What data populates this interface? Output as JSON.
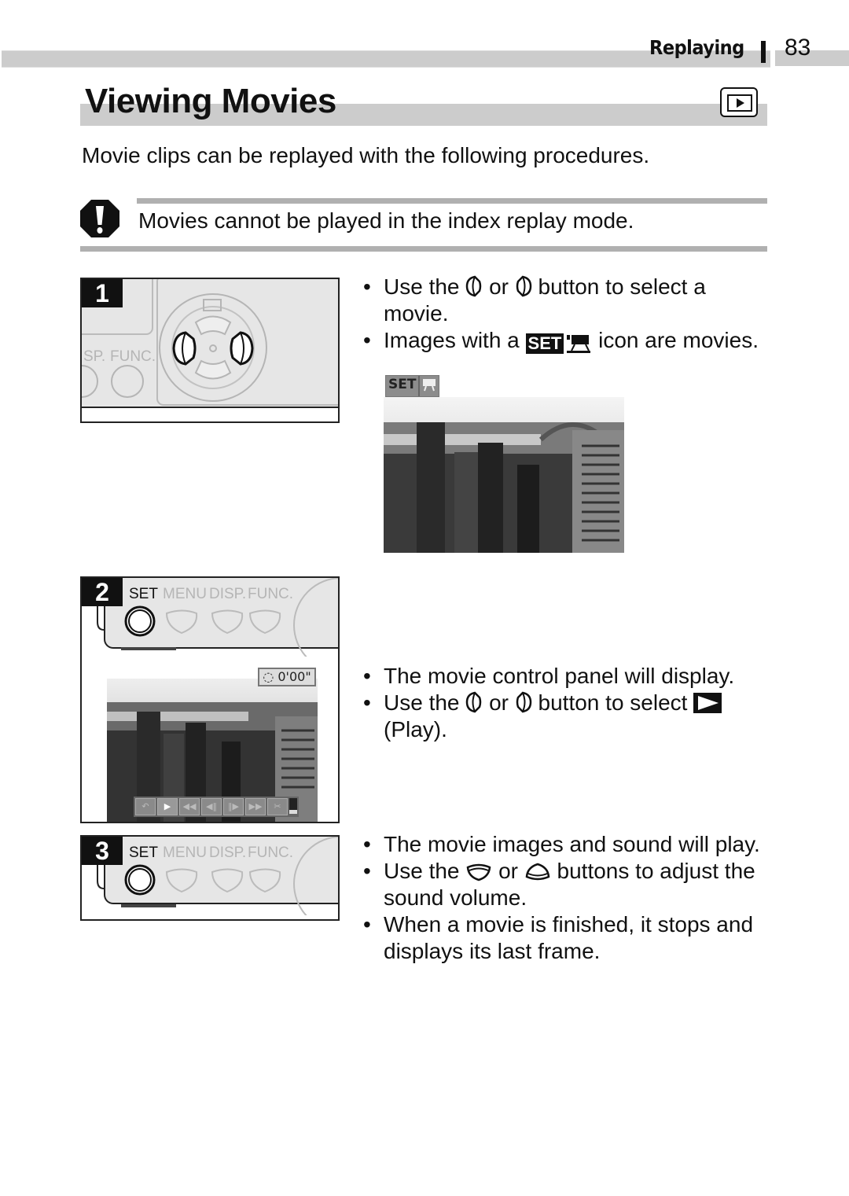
{
  "header": {
    "section": "Replaying",
    "page_number": "83"
  },
  "title": {
    "text": "Viewing Movies",
    "mode_icon": "playback-mode-icon"
  },
  "intro": "Movie clips can be replayed with the following procedures.",
  "caution": {
    "icon": "caution-exclamation-icon",
    "text": "Movies cannot be played in the index replay mode."
  },
  "steps": [
    {
      "number": "1",
      "camera_labels": [
        "SP.",
        "FUNC."
      ],
      "bullets": [
        {
          "before": "Use the",
          "icon1": "left-button-icon",
          "mid": "or",
          "icon2": "right-button-icon",
          "after": "button to select a movie."
        },
        {
          "before": "Images with a",
          "icon": "set-movie-icon",
          "set_label": "SET",
          "after": "icon are movies."
        }
      ],
      "screen_overlay": {
        "set_label": "SET",
        "icon": "movie-camera-icon"
      }
    },
    {
      "number": "2",
      "camera_labels": [
        "SET",
        "MENU",
        "DISP.",
        "FUNC."
      ],
      "timecode": "0'00\"",
      "control_panel": [
        "exit",
        "play",
        "first-frame",
        "previous-frame",
        "next-frame",
        "last-frame",
        "edit"
      ],
      "bullets": [
        {
          "text": "The movie control panel will display."
        },
        {
          "before": "Use the",
          "icon1": "left-button-icon",
          "mid": "or",
          "icon2": "right-button-icon",
          "after": "button to select",
          "icon3": "play-icon",
          "tail": "(Play)."
        }
      ]
    },
    {
      "number": "3",
      "camera_labels": [
        "SET",
        "MENU",
        "DISP.",
        "FUNC."
      ],
      "bullets": [
        {
          "text": "The movie images and sound will play."
        },
        {
          "before": "Use the",
          "icon1": "down-button-icon",
          "mid": "or",
          "icon2": "up-button-icon",
          "after": "buttons to adjust the sound volume."
        },
        {
          "text": "When a movie is finished, it stops and displays its last frame."
        }
      ]
    }
  ],
  "colors": {
    "band_gray": "#cccccc",
    "rule_gray": "#b0b0b0",
    "ink": "#111111"
  }
}
